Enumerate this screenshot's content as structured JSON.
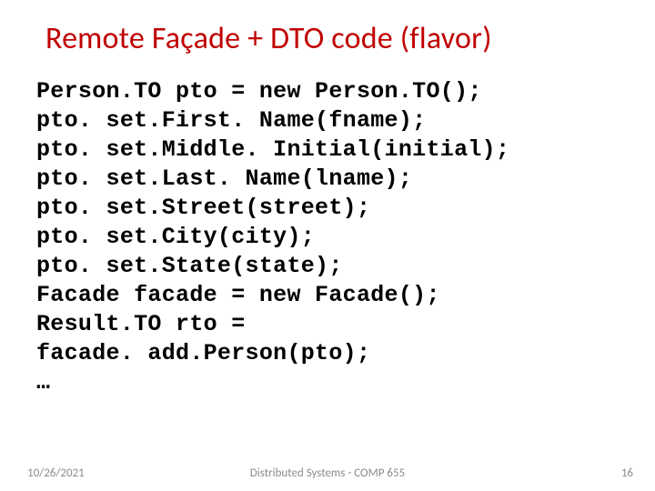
{
  "title": "Remote Façade + DTO code (flavor)",
  "code": {
    "l1": "Person.TO pto = new Person.TO();",
    "l2": "pto. set.First. Name(fname);",
    "l3": "pto. set.Middle. Initial(initial);",
    "l4": "pto. set.Last. Name(lname);",
    "l5": "pto. set.Street(street);",
    "l6": "pto. set.City(city);",
    "l7": "pto. set.State(state);",
    "l8": "Facade facade = new Facade();",
    "l9": "Result.TO rto =",
    "l10": "facade. add.Person(pto);",
    "l11": "…"
  },
  "footer": {
    "date": "10/26/2021",
    "center": "Distributed Systems - COMP 655",
    "page": "16"
  }
}
